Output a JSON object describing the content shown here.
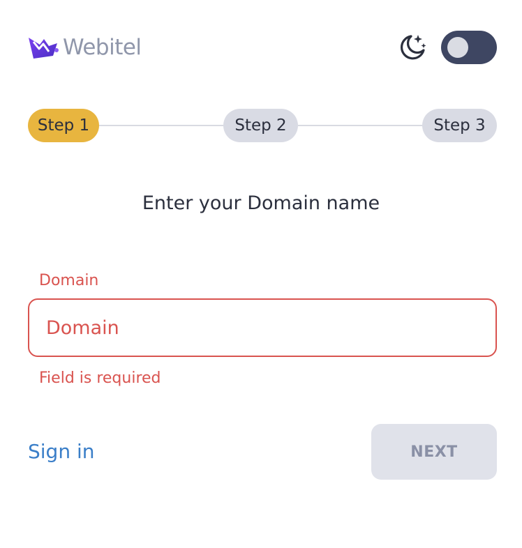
{
  "header": {
    "logo_text": "Webitel",
    "theme_icon": "moon-stars-icon",
    "theme_toggle_on": false
  },
  "stepper": {
    "steps": [
      {
        "label": "Step 1",
        "active": true
      },
      {
        "label": "Step 2",
        "active": false
      },
      {
        "label": "Step 3",
        "active": false
      }
    ]
  },
  "form": {
    "heading": "Enter your Domain name",
    "domain_label": "Domain",
    "domain_placeholder": "Domain",
    "domain_value": "",
    "domain_error": "Field is required"
  },
  "actions": {
    "sign_in_label": "Sign in",
    "next_label": "NEXT",
    "next_disabled": true
  },
  "colors": {
    "accent": "#e8b53f",
    "error": "#d9534f",
    "link": "#3a7ec8",
    "toggle_bg": "#3e4662",
    "brand_purple": "#6b3fd6"
  }
}
